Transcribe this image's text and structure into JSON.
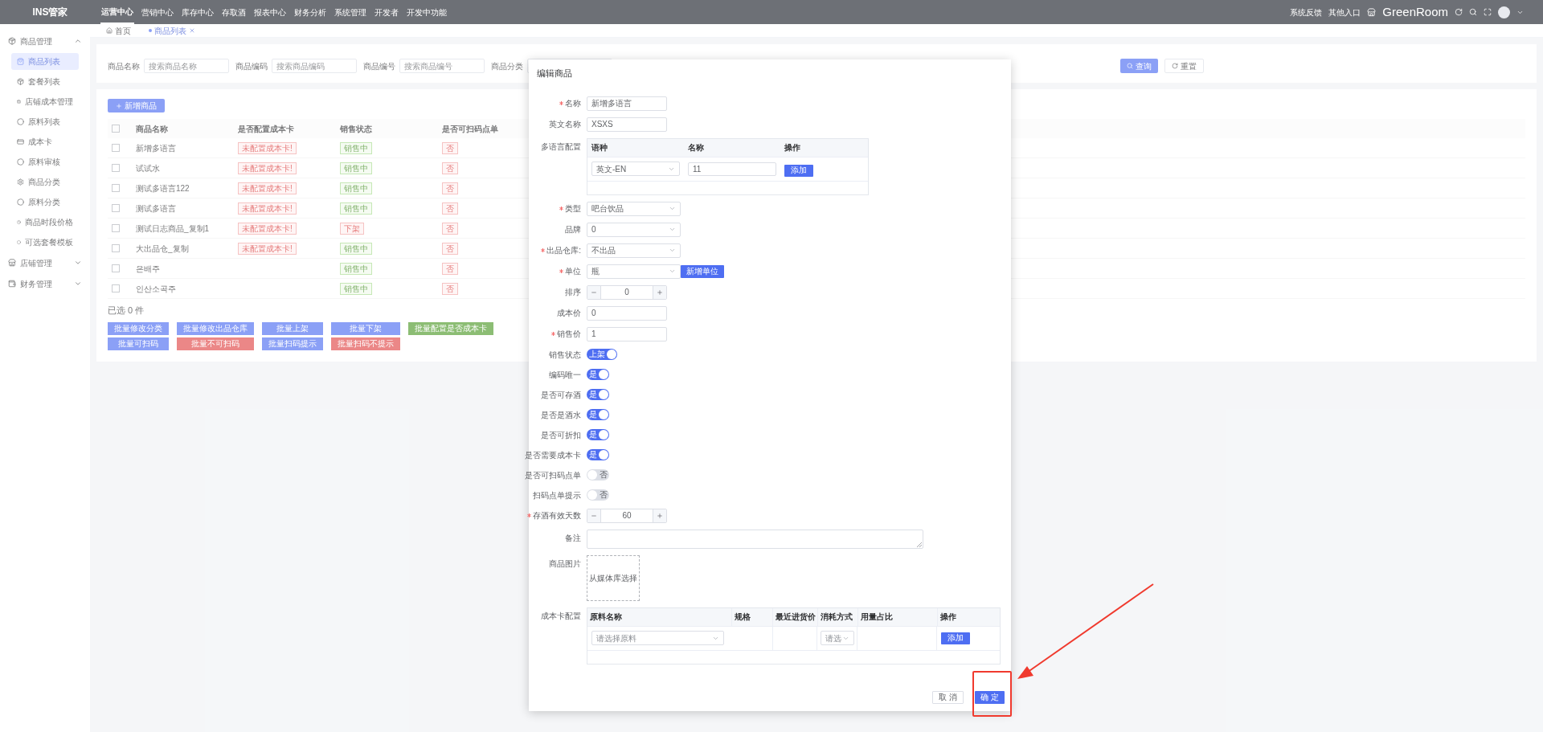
{
  "top_nav": {
    "logo": "INS管家",
    "items": [
      {
        "label": "运营中心",
        "selected": true
      },
      {
        "label": "营销中心",
        "selected": false
      },
      {
        "label": "库存中心",
        "selected": false
      },
      {
        "label": "存取酒",
        "selected": false
      },
      {
        "label": "报表中心",
        "selected": false
      },
      {
        "label": "财务分析",
        "selected": false
      },
      {
        "label": "系统管理",
        "selected": false
      },
      {
        "label": "开发者",
        "selected": false
      },
      {
        "label": "开发中功能",
        "selected": false
      }
    ],
    "right_links": [
      "系统反馈",
      "其他入口"
    ],
    "store": "GreenRoom"
  },
  "tabs": [
    {
      "label": "首页",
      "selected": false,
      "closable": false
    },
    {
      "label": "商品列表",
      "selected": true,
      "closable": true
    }
  ],
  "sidebar": [
    {
      "label": "商品管理",
      "expanded": true,
      "children": [
        {
          "label": "商品列表",
          "selected": true
        },
        {
          "label": "套餐列表",
          "selected": false
        },
        {
          "label": "店铺成本管理",
          "selected": false
        },
        {
          "label": "原料列表",
          "selected": false
        },
        {
          "label": "成本卡",
          "selected": false
        },
        {
          "label": "原料审核",
          "selected": false
        },
        {
          "label": "商品分类",
          "selected": false
        },
        {
          "label": "原料分类",
          "selected": false
        },
        {
          "label": "商品时段价格",
          "selected": false
        },
        {
          "label": "可选套餐模板",
          "selected": false
        }
      ]
    },
    {
      "label": "店铺管理",
      "expanded": false
    },
    {
      "label": "财务管理",
      "expanded": false
    }
  ],
  "filters": [
    {
      "label": "商品名称",
      "placeholder": "搜索商品名称"
    },
    {
      "label": "商品编码",
      "placeholder": "搜索商品编码"
    },
    {
      "label": "商品编号",
      "placeholder": "搜索商品编号"
    },
    {
      "label": "商品分类"
    }
  ],
  "filter_buttons": [
    {
      "label": "查询",
      "kind": "primary"
    },
    {
      "label": "重置",
      "kind": "default"
    }
  ],
  "add_button": "新增商品",
  "table": {
    "all_checked": false,
    "columns": [
      "商品名称",
      "是否配置成本卡",
      "销售状态",
      "是否可扫码点单"
    ],
    "rows": [
      {
        "checked": false,
        "name": "新增多语言",
        "cost_card": "未配置成本卡!",
        "status": "销售中",
        "on_sale": true,
        "scan": "否"
      },
      {
        "checked": false,
        "name": "试试水",
        "cost_card": "未配置成本卡!",
        "status": "销售中",
        "on_sale": true,
        "scan": "否"
      },
      {
        "checked": false,
        "name": "测试多语言122",
        "cost_card": "未配置成本卡!",
        "status": "销售中",
        "on_sale": true,
        "scan": "否"
      },
      {
        "checked": false,
        "name": "测试多语言",
        "cost_card": "未配置成本卡!",
        "status": "销售中",
        "on_sale": true,
        "scan": "否"
      },
      {
        "checked": false,
        "name": "测试日志商品_复制1",
        "cost_card": "未配置成本卡!",
        "status": "下架",
        "on_sale": false,
        "scan": "否"
      },
      {
        "checked": false,
        "name": "大出品仓_复制",
        "cost_card": "未配置成本卡!",
        "status": "销售中",
        "on_sale": true,
        "scan": "否"
      },
      {
        "checked": false,
        "name": "은배주",
        "status": "销售中",
        "on_sale": true,
        "scan": "否"
      },
      {
        "checked": false,
        "name": "인산소곡주",
        "status": "销售中",
        "on_sale": true,
        "scan": "否"
      }
    ]
  },
  "selected_count": "已选 0 件",
  "batch_actions": [
    {
      "label": "批量修改分类",
      "kind": "primary"
    },
    {
      "label": "批量修改出品仓库",
      "kind": "primary"
    },
    {
      "label": "批量上架",
      "kind": "primary"
    },
    {
      "label": "批量下架",
      "kind": "primary"
    },
    {
      "label": "批量配置是否成本卡",
      "kind": "success"
    },
    {
      "label": "批量可扫码",
      "kind": "primary"
    },
    {
      "label": "批量不可扫码",
      "kind": "danger"
    },
    {
      "label": "批量扫码提示",
      "kind": "primary"
    },
    {
      "label": "批量扫码不提示",
      "kind": "danger"
    }
  ],
  "dialog": {
    "title": "编辑商品",
    "fields": [
      {
        "kind": "text",
        "label": "名称",
        "required": true,
        "value": "新增多语言"
      },
      {
        "kind": "text",
        "label": "英文名称",
        "required": false,
        "value": "XSXS"
      },
      {
        "kind": "lang_table",
        "label": "多语言配置",
        "required": false,
        "columns": [
          "语种",
          "名称",
          "操作"
        ],
        "language": "英文-EN",
        "name": "11",
        "action": "添加"
      },
      {
        "kind": "select",
        "label": "类型",
        "required": true,
        "value": "吧台饮品"
      },
      {
        "kind": "select",
        "label": "品牌",
        "required": false,
        "value": "0"
      },
      {
        "kind": "select",
        "label": "出品仓库:",
        "required": true,
        "value": "不出品"
      },
      {
        "kind": "select_add",
        "label": "单位",
        "required": true,
        "value": "瓶",
        "action": "新增单位"
      },
      {
        "kind": "stepper",
        "label": "排序",
        "required": false,
        "value": "0"
      },
      {
        "kind": "text",
        "label": "成本价",
        "required": false,
        "value": "0"
      },
      {
        "kind": "text",
        "label": "销售价",
        "required": true,
        "value": "1"
      },
      {
        "kind": "switch",
        "label": "销售状态",
        "required": false,
        "on": true,
        "text": "上架"
      },
      {
        "kind": "switch",
        "label": "编码唯一",
        "required": false,
        "on": true,
        "text": "是"
      },
      {
        "kind": "switch",
        "label": "是否可存酒",
        "required": false,
        "on": true,
        "text": "是"
      },
      {
        "kind": "switch",
        "label": "是否是酒水",
        "required": false,
        "on": true,
        "text": "是"
      },
      {
        "kind": "switch",
        "label": "是否可折扣",
        "required": false,
        "on": true,
        "text": "是"
      },
      {
        "kind": "switch",
        "label": "是否需要成本卡",
        "required": false,
        "on": true,
        "text": "是"
      },
      {
        "kind": "switch",
        "label": "是否可扫码点单",
        "required": false,
        "on": false,
        "text": "否"
      },
      {
        "kind": "switch",
        "label": "扫码点单提示",
        "required": false,
        "on": false,
        "text": "否"
      },
      {
        "kind": "stepper",
        "label": "存酒有效天数",
        "required": true,
        "value": "60"
      },
      {
        "kind": "textarea",
        "label": "备注",
        "required": false
      },
      {
        "kind": "image",
        "label": "商品图片",
        "required": false,
        "text": "从媒体库选择"
      },
      {
        "kind": "cost_table",
        "label": "成本卡配置",
        "required": false,
        "columns": [
          "原料名称",
          "规格",
          "最近进货价",
          "消耗方式",
          "用量占比",
          "操作"
        ],
        "material_placeholder": "请选择原料",
        "method_placeholder": "请选",
        "action": "添加"
      }
    ],
    "buttons": [
      {
        "label": "取 消",
        "kind": "default"
      },
      {
        "label": "确 定",
        "kind": "primary"
      }
    ]
  }
}
